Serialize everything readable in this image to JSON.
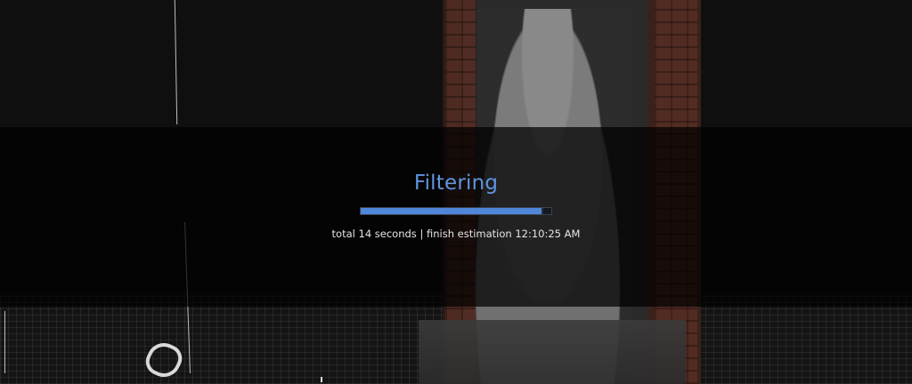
{
  "progress": {
    "title": "Filtering",
    "value": 0.95,
    "status_text": "total 14 seconds | finish estimation 12:10:25 AM"
  }
}
